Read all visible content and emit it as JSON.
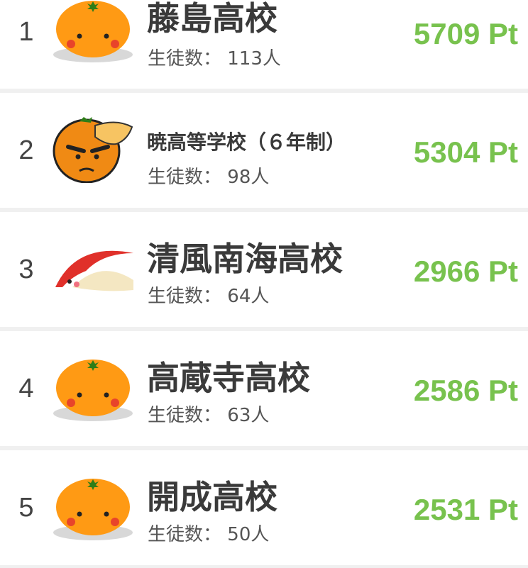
{
  "accent_color": "#78c24e",
  "ranking": [
    {
      "rank": "1",
      "school": "藤島高校",
      "students_label": "生徒数：",
      "students": "113人",
      "points": "5709 Pt",
      "icon": "mikan-mascot-icon"
    },
    {
      "rank": "2",
      "school": "暁高等学校（６年制）",
      "students_label": "生徒数：",
      "students": "98人",
      "points": "5304 Pt",
      "icon": "angry-mikan-mascot-icon"
    },
    {
      "rank": "3",
      "school": "清風南海高校",
      "students_label": "生徒数：",
      "students": "64人",
      "points": "2966 Pt",
      "icon": "white-bird-mascot-icon"
    },
    {
      "rank": "4",
      "school": "高蔵寺高校",
      "students_label": "生徒数：",
      "students": "63人",
      "points": "2586 Pt",
      "icon": "mikan-mascot-icon"
    },
    {
      "rank": "5",
      "school": "開成高校",
      "students_label": "生徒数：",
      "students": "50人",
      "points": "2531 Pt",
      "icon": "mikan-mascot-icon"
    }
  ]
}
